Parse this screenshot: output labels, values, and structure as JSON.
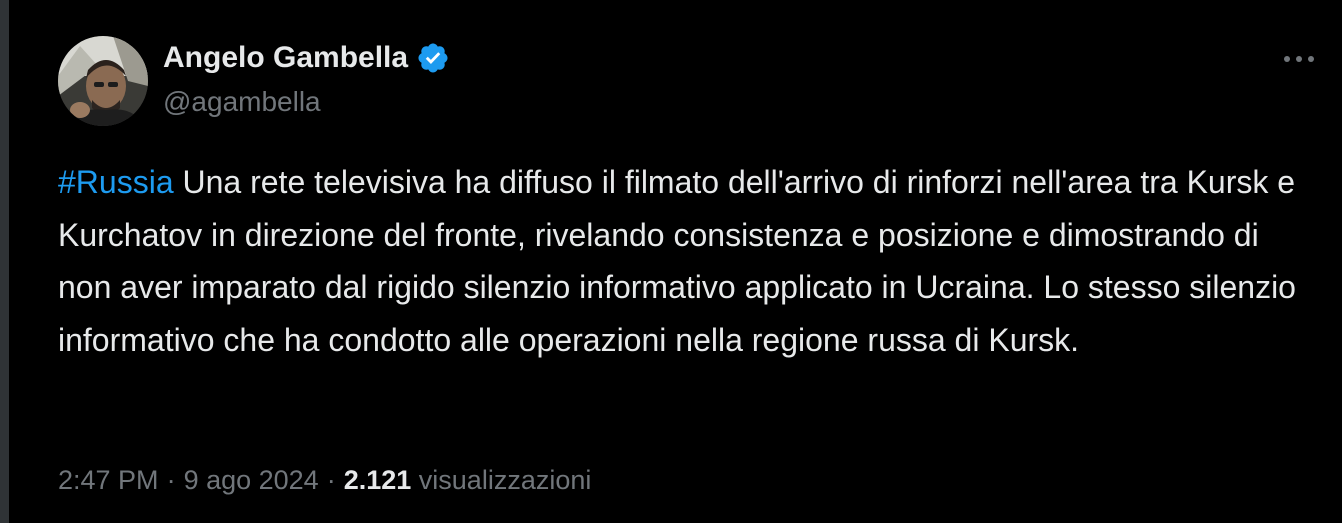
{
  "tweet": {
    "author": {
      "display_name": "Angelo Gambella",
      "handle": "@agambella",
      "verified": true,
      "verified_icon": "verified-badge-icon"
    },
    "more_icon": "more-horizontal-icon",
    "text": {
      "hashtag": "#Russia",
      "body": " Una rete televisiva ha diffuso il filmato dell'arrivo di rinforzi nell'area tra Kursk e Kurchatov in direzione del fronte, rivelando consistenza e posizione e dimostrando di non aver imparato dal rigido silenzio informativo applicato in Ucraina. Lo stesso silenzio informativo che ha condotto alle operazioni nella regione russa di Kursk."
    },
    "meta": {
      "time": "2:47 PM",
      "separator": "·",
      "date": "9 ago 2024",
      "views_count": "2.121",
      "views_label": "visualizzazioni"
    }
  },
  "colors": {
    "background": "#000000",
    "text_primary": "#e7e9ea",
    "text_secondary": "#71767b",
    "accent": "#1d9bf0"
  }
}
